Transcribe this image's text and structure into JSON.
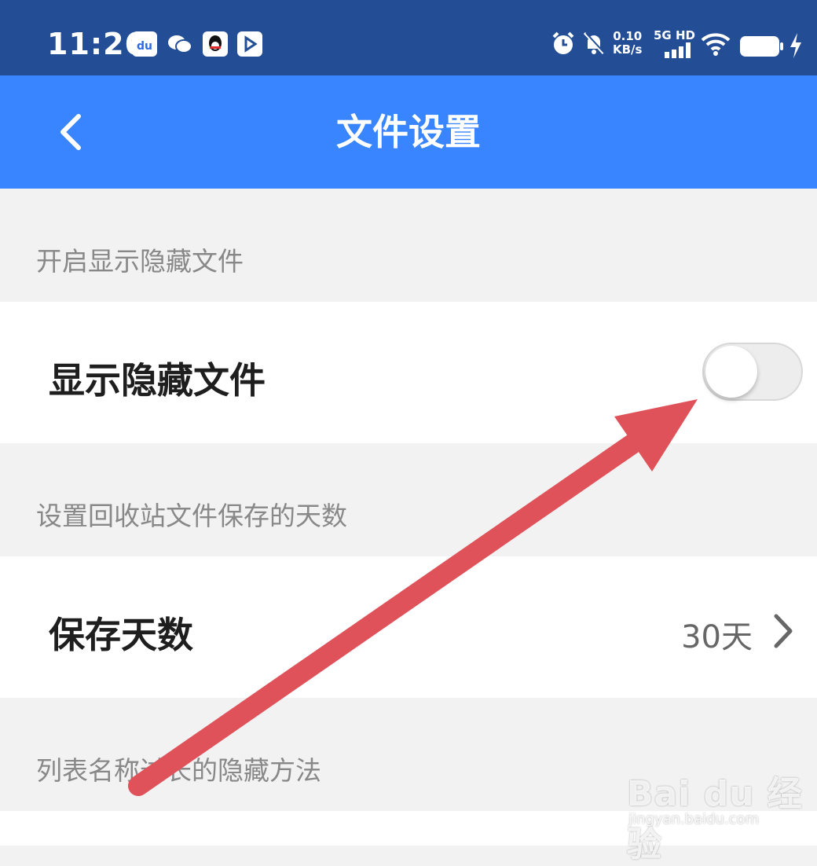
{
  "status_bar": {
    "time": "11:26",
    "net_speed_value": "0.10",
    "net_speed_unit": "KB/s",
    "network_label": "5G HD",
    "apps": [
      "baidu-app-icon",
      "wechat-icon",
      "qq-icon",
      "video-app-icon"
    ],
    "status_icons": [
      "alarm-icon",
      "mute-icon",
      "signal-icon",
      "wifi-icon",
      "battery-icon",
      "charging-icon"
    ]
  },
  "title_bar": {
    "title": "文件设置",
    "back_icon": "chevron-left-icon",
    "color": "#3885ff"
  },
  "sections": [
    {
      "header": "开启显示隐藏文件",
      "item_label": "显示隐藏文件",
      "toggle_on": false
    },
    {
      "header": "设置回收站文件保存的天数",
      "item_label": "保存天数",
      "item_value": "30天",
      "chevron_icon": "chevron-right-icon"
    },
    {
      "header": "列表名称过长的隐藏方法"
    }
  ],
  "annotation": {
    "arrow_color": "#e0525a"
  },
  "watermark": {
    "brand": "Bai du 经验",
    "url": "jingyan.baidu.com"
  }
}
